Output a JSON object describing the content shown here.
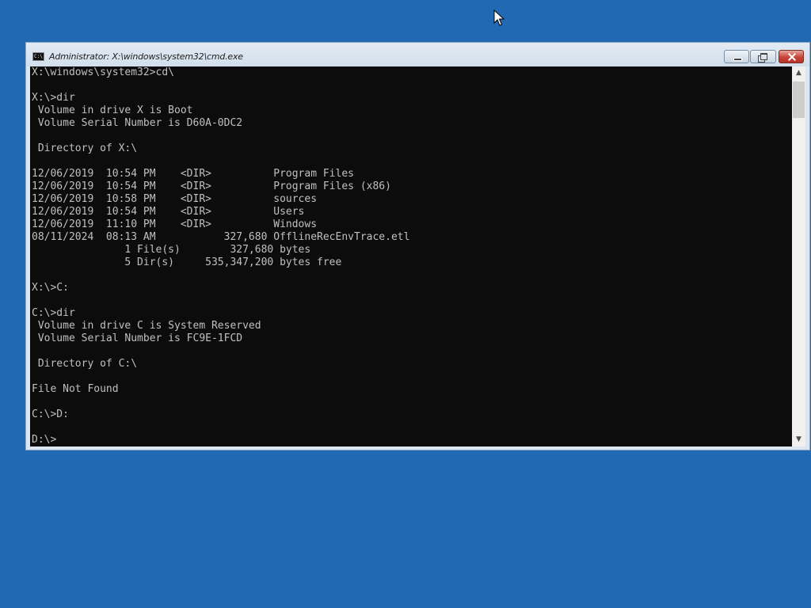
{
  "window": {
    "title": "Administrator: X:\\windows\\system32\\cmd.exe",
    "app_icon_text": "C:\\",
    "buttons": {
      "minimize": "minimize",
      "maximize": "maximize",
      "close": "close"
    }
  },
  "console": {
    "lines": [
      "X:\\windows\\system32>cd\\",
      "",
      "X:\\>dir",
      " Volume in drive X is Boot",
      " Volume Serial Number is D60A-0DC2",
      "",
      " Directory of X:\\",
      "",
      "12/06/2019  10:54 PM    <DIR>          Program Files",
      "12/06/2019  10:54 PM    <DIR>          Program Files (x86)",
      "12/06/2019  10:58 PM    <DIR>          sources",
      "12/06/2019  10:54 PM    <DIR>          Users",
      "12/06/2019  11:10 PM    <DIR>          Windows",
      "08/11/2024  08:13 AM           327,680 OfflineRecEnvTrace.etl",
      "               1 File(s)        327,680 bytes",
      "               5 Dir(s)     535,347,200 bytes free",
      "",
      "X:\\>C:",
      "",
      "C:\\>dir",
      " Volume in drive C is System Reserved",
      " Volume Serial Number is FC9E-1FCD",
      "",
      " Directory of C:\\",
      "",
      "File Not Found",
      "",
      "C:\\>D:",
      "",
      "D:\\>"
    ]
  },
  "scrollbar": {
    "up_arrow": "▲",
    "down_arrow": "▼"
  },
  "colors": {
    "desktop": "#2169b3",
    "console_bg": "#0c0c0c",
    "console_fg": "#c0c0c0"
  },
  "icons": {
    "cursor": "arrow-cursor-icon",
    "app": "cmd-icon"
  }
}
